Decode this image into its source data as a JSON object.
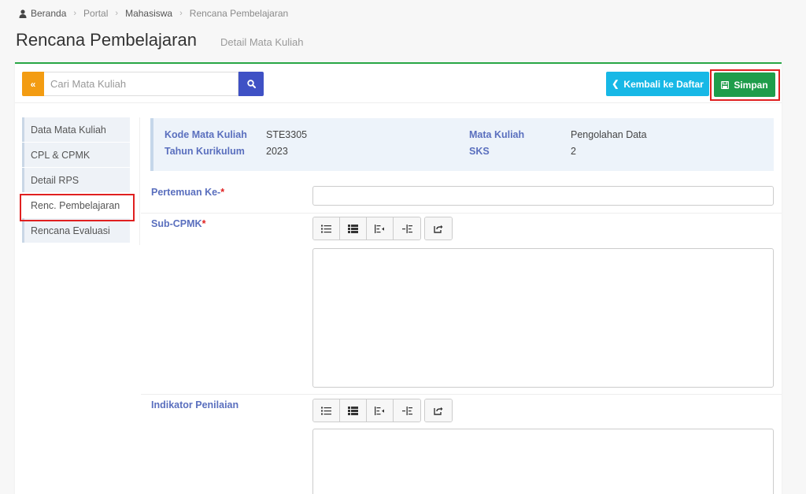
{
  "breadcrumb": {
    "items": [
      "Beranda",
      "Portal",
      "Mahasiswa",
      "Rencana Pembelajaran"
    ]
  },
  "page": {
    "title": "Rencana Pembelajaran",
    "subtitle": "Detail Mata Kuliah"
  },
  "toolbar": {
    "collapse_label": "«",
    "search_placeholder": "Cari Mata Kuliah",
    "search_value": "",
    "back_label": "Kembali ke Daftar",
    "save_label": "Simpan"
  },
  "sidebar": {
    "items": [
      {
        "label": "Data Mata Kuliah"
      },
      {
        "label": "CPL & CPMK"
      },
      {
        "label": "Detail RPS"
      },
      {
        "label": "Renc. Pembelajaran"
      },
      {
        "label": "Rencana Evaluasi"
      }
    ],
    "active_index": 3
  },
  "course_info": {
    "kode_label": "Kode Mata Kuliah",
    "kode_value": "STE3305",
    "tahun_label": "Tahun Kurikulum",
    "tahun_value": "2023",
    "mk_label": "Mata Kuliah",
    "mk_value": "Pengolahan Data",
    "sks_label": "SKS",
    "sks_value": "2"
  },
  "form": {
    "pertemuan_label": "Pertemuan Ke-",
    "subcpmk_label": "Sub-CPMK",
    "indikator_label": "Indikator Penilaian",
    "required_mark": "*",
    "pertemuan_value": ""
  },
  "colors": {
    "accent_green": "#1f9d4b",
    "accent_blue": "#3f51c5",
    "accent_cyan": "#17b8e6",
    "accent_orange": "#f39c12",
    "highlight_red": "#e02020"
  },
  "icons": {
    "home": "user-icon",
    "search": "search-icon",
    "back": "chevron-left-icon",
    "save": "floppy-disk-icon",
    "editor": [
      "unordered-list-icon",
      "ordered-list-icon",
      "outdent-icon",
      "indent-icon",
      "redo-icon"
    ]
  }
}
